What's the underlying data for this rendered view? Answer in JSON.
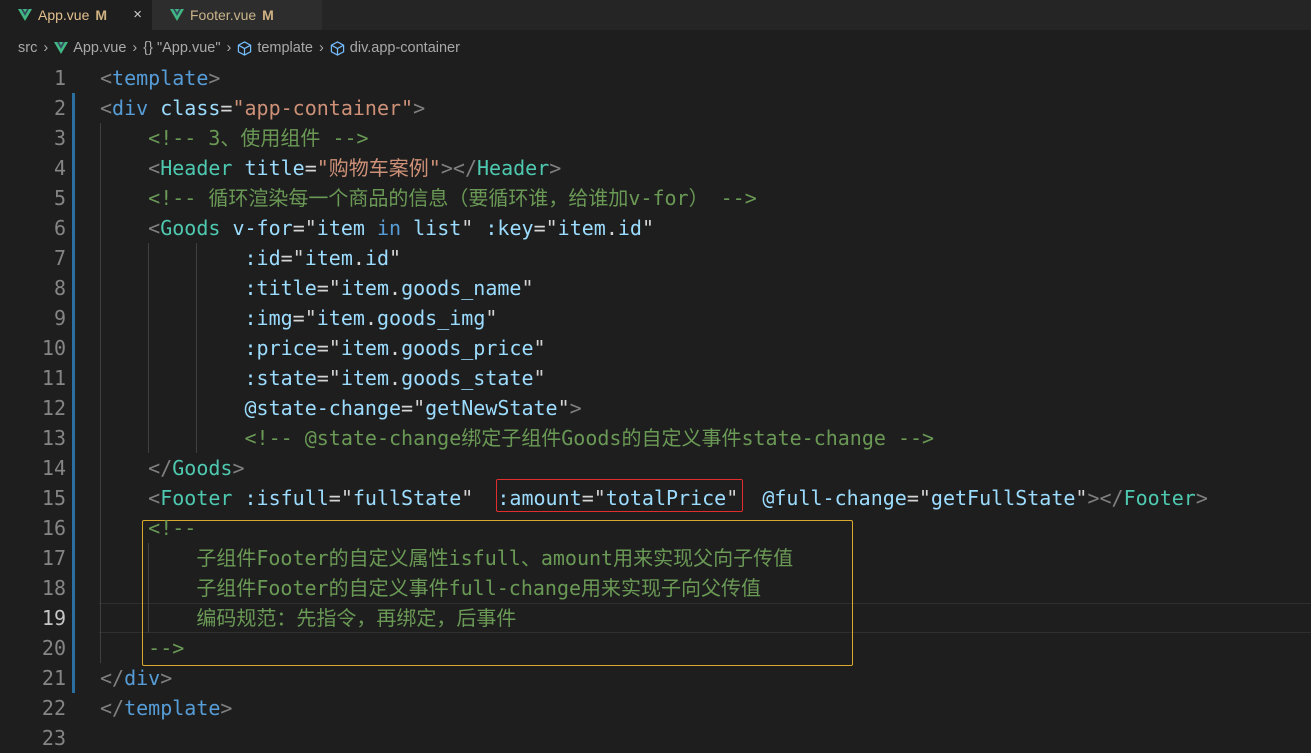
{
  "tabs": [
    {
      "label": "App.vue",
      "modified": "M",
      "close": "×"
    },
    {
      "label": "Footer.vue",
      "modified": "M"
    }
  ],
  "breadcrumb": [
    "src",
    "App.vue",
    "{} \"App.vue\"",
    "template",
    "div.app-container"
  ],
  "colors": {
    "vue_green": "#41b883",
    "highlight_red": "#e02d2d",
    "highlight_yellow": "#d8a92c"
  },
  "line_numbers": [
    "1",
    "2",
    "3",
    "4",
    "5",
    "6",
    "7",
    "8",
    "9",
    "10",
    "11",
    "12",
    "13",
    "14",
    "15",
    "16",
    "17",
    "18",
    "19",
    "20",
    "21",
    "22",
    "23"
  ],
  "lines": [
    [
      [
        "p",
        "<"
      ],
      [
        "t",
        "template"
      ],
      [
        "p",
        ">"
      ]
    ],
    [
      [
        "p",
        "<"
      ],
      [
        "t",
        "div"
      ],
      [
        "a",
        " class"
      ],
      [
        "d",
        "="
      ],
      [
        "s",
        "\"app-container\""
      ],
      [
        "p",
        ">"
      ]
    ],
    [
      [
        "d",
        "    "
      ],
      [
        "cm",
        "<!-- 3、使用组件 -->"
      ]
    ],
    [
      [
        "d",
        "    "
      ],
      [
        "p",
        "<"
      ],
      [
        "c",
        "Header"
      ],
      [
        "a",
        " title"
      ],
      [
        "d",
        "="
      ],
      [
        "s",
        "\"购物车案例\""
      ],
      [
        "p",
        "></"
      ],
      [
        "c",
        "Header"
      ],
      [
        "p",
        ">"
      ]
    ],
    [
      [
        "d",
        "    "
      ],
      [
        "cm",
        "<!-- 循环渲染每一个商品的信息（要循环谁，给谁加v-for） -->"
      ]
    ],
    [
      [
        "d",
        "    "
      ],
      [
        "p",
        "<"
      ],
      [
        "c",
        "Goods"
      ],
      [
        "a",
        " v-for"
      ],
      [
        "d",
        "="
      ],
      [
        "d",
        "\""
      ],
      [
        "a",
        "item"
      ],
      [
        "k",
        " in"
      ],
      [
        "a",
        " list"
      ],
      [
        "d",
        "\""
      ],
      [
        "a",
        " :key"
      ],
      [
        "d",
        "="
      ],
      [
        "d",
        "\""
      ],
      [
        "a",
        "item"
      ],
      [
        "d",
        "."
      ],
      [
        "a",
        "id"
      ],
      [
        "d",
        "\""
      ]
    ],
    [
      [
        "d",
        "            "
      ],
      [
        "a",
        ":id"
      ],
      [
        "d",
        "="
      ],
      [
        "d",
        "\""
      ],
      [
        "a",
        "item"
      ],
      [
        "d",
        "."
      ],
      [
        "a",
        "id"
      ],
      [
        "d",
        "\""
      ]
    ],
    [
      [
        "d",
        "            "
      ],
      [
        "a",
        ":title"
      ],
      [
        "d",
        "="
      ],
      [
        "d",
        "\""
      ],
      [
        "a",
        "item"
      ],
      [
        "d",
        "."
      ],
      [
        "a",
        "goods_name"
      ],
      [
        "d",
        "\""
      ]
    ],
    [
      [
        "d",
        "            "
      ],
      [
        "a",
        ":img"
      ],
      [
        "d",
        "="
      ],
      [
        "d",
        "\""
      ],
      [
        "a",
        "item"
      ],
      [
        "d",
        "."
      ],
      [
        "a",
        "goods_img"
      ],
      [
        "d",
        "\""
      ]
    ],
    [
      [
        "d",
        "            "
      ],
      [
        "a",
        ":price"
      ],
      [
        "d",
        "="
      ],
      [
        "d",
        "\""
      ],
      [
        "a",
        "item"
      ],
      [
        "d",
        "."
      ],
      [
        "a",
        "goods_price"
      ],
      [
        "d",
        "\""
      ]
    ],
    [
      [
        "d",
        "            "
      ],
      [
        "a",
        ":state"
      ],
      [
        "d",
        "="
      ],
      [
        "d",
        "\""
      ],
      [
        "a",
        "item"
      ],
      [
        "d",
        "."
      ],
      [
        "a",
        "goods_state"
      ],
      [
        "d",
        "\""
      ]
    ],
    [
      [
        "d",
        "            "
      ],
      [
        "a",
        "@state-change"
      ],
      [
        "d",
        "="
      ],
      [
        "d",
        "\""
      ],
      [
        "a",
        "getNewState"
      ],
      [
        "d",
        "\""
      ],
      [
        "p",
        ">"
      ]
    ],
    [
      [
        "d",
        "            "
      ],
      [
        "cm",
        "<!-- @state-change绑定子组件Goods的自定义事件state-change -->"
      ]
    ],
    [
      [
        "d",
        "    "
      ],
      [
        "p",
        "</"
      ],
      [
        "c",
        "Goods"
      ],
      [
        "p",
        ">"
      ]
    ],
    [
      [
        "d",
        "    "
      ],
      [
        "p",
        "<"
      ],
      [
        "c",
        "Footer"
      ],
      [
        "a",
        " :isfull"
      ],
      [
        "d",
        "="
      ],
      [
        "d",
        "\""
      ],
      [
        "a",
        "fullState"
      ],
      [
        "d",
        "\""
      ],
      [
        "a",
        "  :amount"
      ],
      [
        "d",
        "="
      ],
      [
        "d",
        "\""
      ],
      [
        "a",
        "totalPrice"
      ],
      [
        "d",
        "\""
      ],
      [
        "a",
        "  @full-change"
      ],
      [
        "d",
        "="
      ],
      [
        "d",
        "\""
      ],
      [
        "a",
        "getFullState"
      ],
      [
        "d",
        "\""
      ],
      [
        "p",
        "></"
      ],
      [
        "c",
        "Footer"
      ],
      [
        "p",
        ">"
      ]
    ],
    [
      [
        "d",
        "    "
      ],
      [
        "cm",
        "<!--"
      ]
    ],
    [
      [
        "d",
        "        "
      ],
      [
        "cm",
        "子组件Footer的自定义属性isfull、amount用来实现父向子传值"
      ]
    ],
    [
      [
        "d",
        "        "
      ],
      [
        "cm",
        "子组件Footer的自定义事件full-change用来实现子向父传值"
      ]
    ],
    [
      [
        "d",
        "        "
      ],
      [
        "cm",
        "编码规范：先指令，再绑定，后事件"
      ]
    ],
    [
      [
        "d",
        "    "
      ],
      [
        "cm",
        "-->"
      ]
    ],
    [
      [
        "p",
        "</"
      ],
      [
        "t",
        "div"
      ],
      [
        "p",
        ">"
      ]
    ],
    [
      [
        "p",
        "</"
      ],
      [
        "t",
        "template"
      ],
      [
        "p",
        ">"
      ]
    ],
    []
  ]
}
